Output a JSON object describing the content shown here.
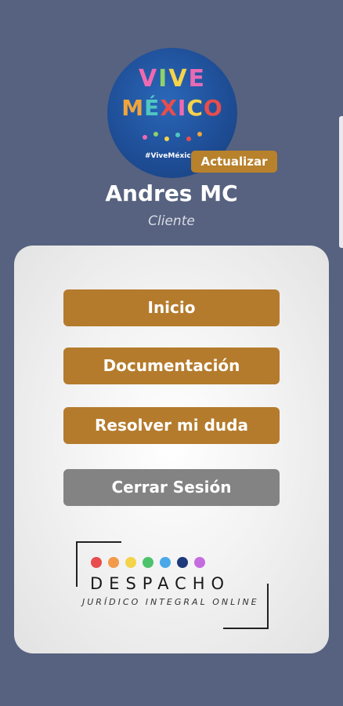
{
  "profile": {
    "avatar_line1": "VIVE",
    "avatar_line2": "MÉXICO",
    "avatar_hashtag": "#ViveMéxico",
    "update_label": "Actualizar",
    "name": "Andres MC",
    "role": "Cliente"
  },
  "menu": {
    "items": [
      {
        "label": "Inicio",
        "style": "gold"
      },
      {
        "label": "Documentación",
        "style": "gold"
      },
      {
        "label": "Resolver mi duda",
        "style": "gold"
      },
      {
        "label": "Cerrar Sesión",
        "style": "gray"
      }
    ]
  },
  "logo": {
    "brand": "DESPACHO",
    "tagline": "JURÍDICO INTEGRAL ONLINE",
    "dot_colors": [
      "#e84c4c",
      "#f39a4a",
      "#f3d34a",
      "#4cc36b",
      "#4aa8e8",
      "#1f3a7a",
      "#c56be0"
    ]
  },
  "colors": {
    "background": "#56627f",
    "accent": "#b47b2c",
    "secondary": "#838383"
  }
}
